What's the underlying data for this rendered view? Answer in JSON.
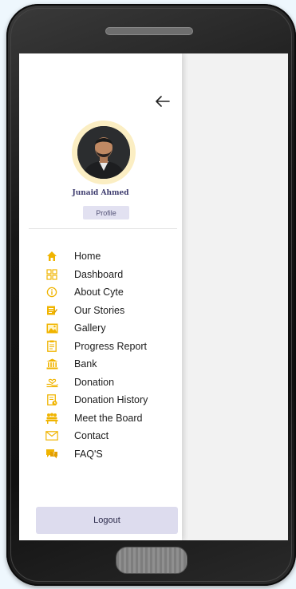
{
  "profile": {
    "name": "Junaid Ahmed",
    "profile_button": "Profile"
  },
  "menu": {
    "items": [
      {
        "label": "Home",
        "icon": "home-icon"
      },
      {
        "label": "Dashboard",
        "icon": "dashboard-icon"
      },
      {
        "label": "About Cyte",
        "icon": "info-icon"
      },
      {
        "label": "Our Stories",
        "icon": "stories-icon"
      },
      {
        "label": "Gallery",
        "icon": "gallery-icon"
      },
      {
        "label": "Progress Report",
        "icon": "report-icon"
      },
      {
        "label": "Bank",
        "icon": "bank-icon"
      },
      {
        "label": "Donation",
        "icon": "donation-icon"
      },
      {
        "label": "Donation History",
        "icon": "history-icon"
      },
      {
        "label": "Meet the Board",
        "icon": "board-icon"
      },
      {
        "label": "Contact",
        "icon": "contact-icon"
      },
      {
        "label": "FAQ'S",
        "icon": "faq-icon"
      }
    ]
  },
  "logout_label": "Logout",
  "colors": {
    "accent": "#f0b400",
    "button_bg": "#dddcee",
    "name_text": "#3c3a6d"
  }
}
